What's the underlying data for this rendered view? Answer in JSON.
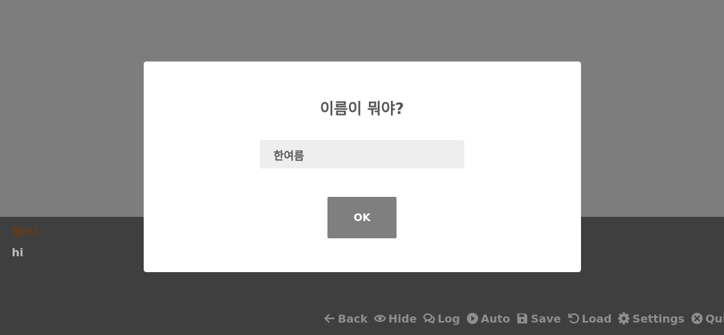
{
  "scene": {
    "speaker_name": "할머니",
    "dialogue_text": "hi"
  },
  "quick_menu": {
    "items": [
      {
        "label": "Back",
        "icon": "arrow-left-icon"
      },
      {
        "label": "Hide",
        "icon": "eye-icon"
      },
      {
        "label": "Log",
        "icon": "chat-bubbles-icon"
      },
      {
        "label": "Auto",
        "icon": "play-circle-icon"
      },
      {
        "label": "Save",
        "icon": "floppy-disk-icon"
      },
      {
        "label": "Load",
        "icon": "undo-icon"
      },
      {
        "label": "Settings",
        "icon": "gear-icon"
      },
      {
        "label": "Quit",
        "icon": "close-circle-icon"
      }
    ]
  },
  "modal": {
    "title": "이름이 뭐야?",
    "input_value": "한여름",
    "ok_label": "OK"
  },
  "colors": {
    "background": "#7d7d7d",
    "textbox": "#3f3f3f",
    "speaker": "#6b3a12",
    "modal": "#ffffff",
    "input_bg": "#eeeeee",
    "button": "#7f7f7f",
    "menu_text": "#8e8e8e"
  }
}
